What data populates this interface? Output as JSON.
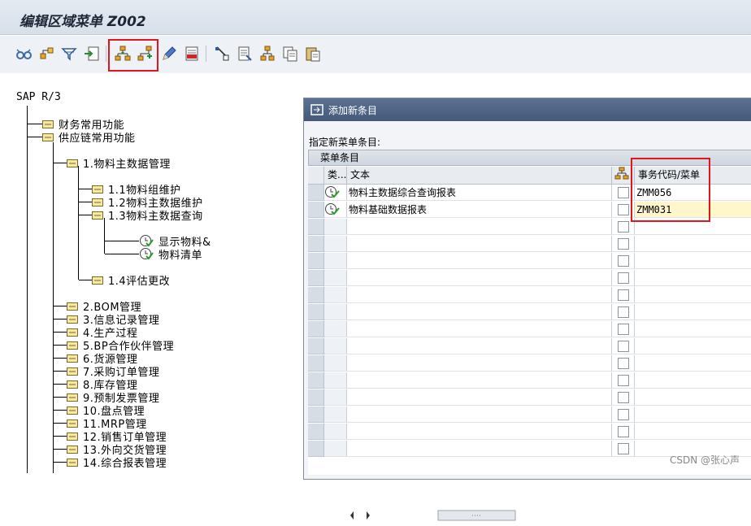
{
  "window": {
    "title": "编辑区域菜单 Z002"
  },
  "toolbar": {
    "buttons": [
      {
        "name": "glasses-icon"
      },
      {
        "name": "hierarchy-icon"
      },
      {
        "name": "filter-icon"
      },
      {
        "name": "import-icon"
      },
      {
        "name": "insert-same-level-icon"
      },
      {
        "name": "insert-sub-level-icon"
      },
      {
        "name": "pencil-icon"
      },
      {
        "name": "delete-icon"
      },
      {
        "name": "cut-icon"
      },
      {
        "name": "document-icon"
      },
      {
        "name": "move-icon"
      },
      {
        "name": "copy-icon"
      },
      {
        "name": "paste-icon"
      }
    ],
    "highlight_color": "#e0161c"
  },
  "tree": {
    "root": "SAP R/3",
    "nodes": [
      "财务常用功能",
      "供应链常用功能",
      "1.物料主数据管理",
      "1.1物料组维护",
      "1.2物料主数据维护",
      "1.3物料主数据查询",
      "显示物料&",
      "物料清单",
      "1.4评估更改",
      "2.BOM管理",
      "3.信息记录管理",
      "4.生产过程",
      "5.BP合作伙伴管理",
      "6.货源管理",
      "7.采购订单管理",
      "8.库存管理",
      "9.预制发票管理",
      "10.盘点管理",
      "11.MRP管理",
      "12.销售订单管理",
      "13.外向交货管理",
      "14.综合报表管理"
    ]
  },
  "dialog": {
    "title": "添加新条目",
    "subtitle": "指定新菜单条目:",
    "grid_caption": "菜单条目",
    "columns": {
      "type": "类...",
      "text": "文本",
      "code": "事务代码/菜单"
    },
    "rows": [
      {
        "text": "物料主数据综合查询报表",
        "code": "ZMM056"
      },
      {
        "text": "物料基础数据报表",
        "code": "ZMM031"
      }
    ]
  },
  "watermark": "CSDN @张心声"
}
